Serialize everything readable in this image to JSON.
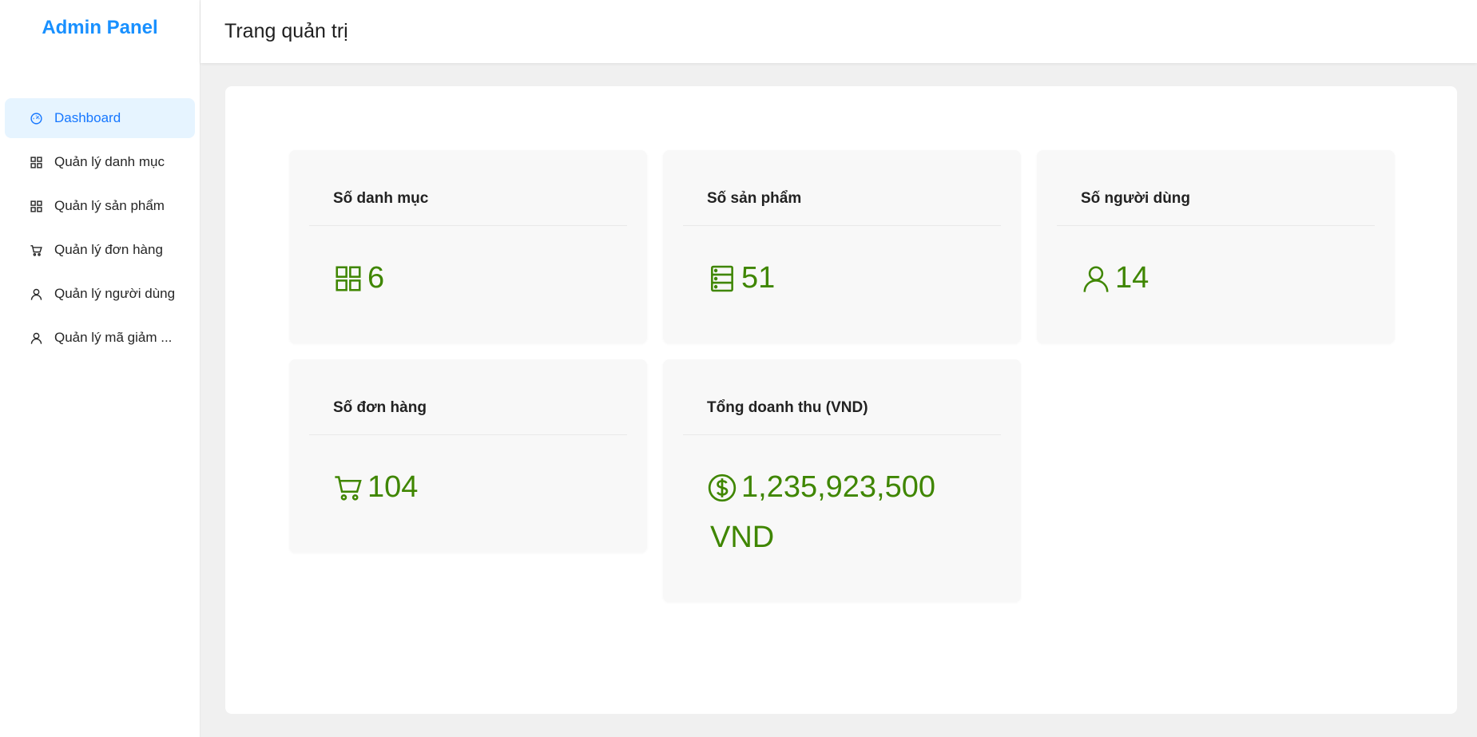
{
  "sidebar": {
    "brand": "Admin Panel",
    "items": [
      {
        "label": "Dashboard",
        "icon": "dashboard-icon",
        "active": true
      },
      {
        "label": "Quản lý danh mục",
        "icon": "grid-icon"
      },
      {
        "label": "Quản lý sản phẩm",
        "icon": "grid-icon"
      },
      {
        "label": "Quản lý đơn hàng",
        "icon": "cart-icon"
      },
      {
        "label": "Quản lý người dùng",
        "icon": "user-icon"
      },
      {
        "label": "Quản lý mã giảm ...",
        "icon": "user-icon"
      }
    ]
  },
  "header": {
    "title": "Trang quản trị"
  },
  "stats": {
    "categories": {
      "title": "Số danh mục",
      "value": "6",
      "icon": "grid-icon"
    },
    "products": {
      "title": "Số sản phẩm",
      "value": "51",
      "icon": "database-icon"
    },
    "users": {
      "title": "Số người dùng",
      "value": "14",
      "icon": "user-icon"
    },
    "orders": {
      "title": "Số đơn hàng",
      "value": "104",
      "icon": "cart-icon"
    },
    "revenue": {
      "title": "Tổng doanh thu (VND)",
      "value": "1,235,923,500",
      "suffix": "VND",
      "icon": "dollar-icon"
    }
  },
  "colors": {
    "accent": "#1677ff",
    "brand": "#1890ff",
    "stat_value": "#3f8600",
    "active_bg": "#e6f4ff"
  }
}
